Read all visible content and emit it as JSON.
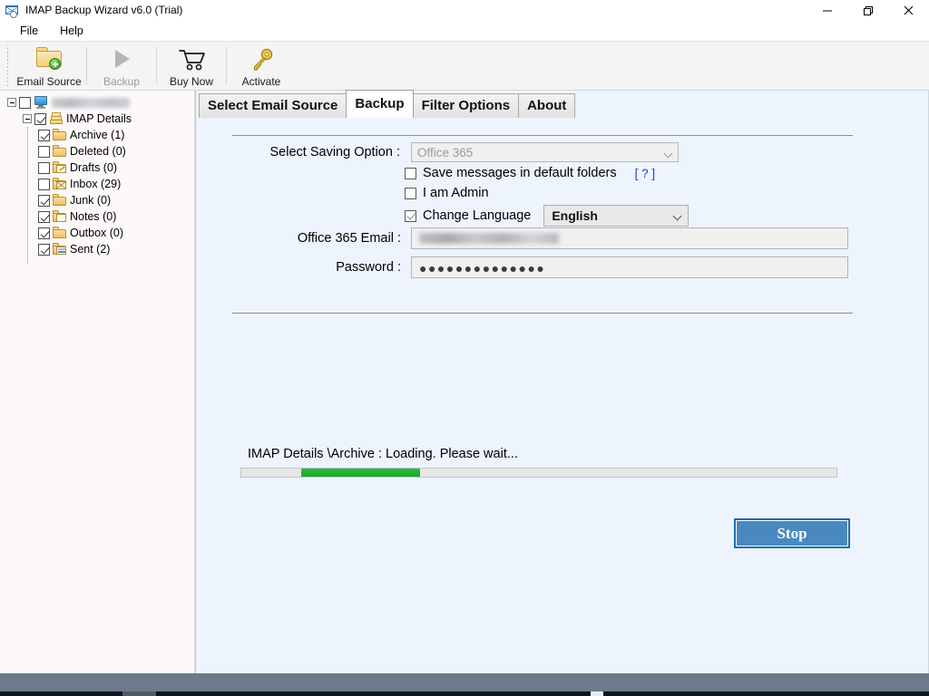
{
  "window": {
    "title": "IMAP Backup Wizard v6.0 (Trial)",
    "icon": "mail-wizard-icon",
    "minimize_label": "–",
    "maximize_label": "❐",
    "close_label": "✕"
  },
  "menubar": {
    "items": [
      {
        "label": "File",
        "name": "menu-file"
      },
      {
        "label": "Help",
        "name": "menu-help"
      }
    ]
  },
  "toolbar": {
    "items": [
      {
        "label": "Email Source",
        "icon": "folder-add-icon",
        "disabled": false
      },
      {
        "label": "Backup",
        "icon": "play-icon",
        "disabled": true
      },
      {
        "label": "Buy Now",
        "icon": "shopping-cart-icon",
        "disabled": false
      },
      {
        "label": "Activate",
        "icon": "key-icon",
        "disabled": false
      }
    ]
  },
  "tree": {
    "root": {
      "label": "",
      "redacted": true,
      "icon": "computer-monitor-icon",
      "expander": "minus",
      "checked": false
    },
    "account": {
      "label": "IMAP Details",
      "icon": "folder-stack-icon",
      "expander": "minus",
      "checked": true
    },
    "folders": [
      {
        "label": "Archive (1)",
        "icon": "folder-icon",
        "checked": true
      },
      {
        "label": "Deleted (0)",
        "icon": "folder-icon",
        "checked": false
      },
      {
        "label": "Drafts (0)",
        "icon": "folder-drafts-icon",
        "checked": false
      },
      {
        "label": "Inbox (29)",
        "icon": "folder-inbox-icon",
        "checked": false
      },
      {
        "label": "Junk (0)",
        "icon": "folder-icon",
        "checked": true
      },
      {
        "label": "Notes (0)",
        "icon": "folder-notes-icon",
        "checked": true
      },
      {
        "label": "Outbox (0)",
        "icon": "folder-icon",
        "checked": true
      },
      {
        "label": "Sent (2)",
        "icon": "folder-sent-icon",
        "checked": true
      }
    ]
  },
  "tabs": [
    {
      "label": "Select Email Source",
      "active": false
    },
    {
      "label": "Backup",
      "active": true
    },
    {
      "label": "Filter Options",
      "active": false
    },
    {
      "label": "About",
      "active": false
    }
  ],
  "form": {
    "saving_option": {
      "label": "Select Saving Option :",
      "value": "Office 365",
      "disabled": true
    },
    "checkboxes": [
      {
        "label": "Save messages in default folders",
        "checked": false,
        "name": "save-default-folders-checkbox"
      },
      {
        "label": "I am Admin",
        "checked": false,
        "name": "i-am-admin-checkbox"
      },
      {
        "label": "Change Language",
        "checked": true,
        "name": "change-language-checkbox"
      }
    ],
    "help_link": "[ ? ]",
    "language": {
      "value": "English"
    },
    "email": {
      "label": "Office 365 Email        :",
      "value": "",
      "redacted": true
    },
    "password": {
      "label": "Password :",
      "value": "●●●●●●●●●●●●●●"
    }
  },
  "progress": {
    "status_text": "IMAP Details \\Archive : Loading. Please wait...",
    "style": "marquee",
    "chunk_start_percent": 10,
    "chunk_width_percent": 20,
    "accent_color": "#1aa52c"
  },
  "actions": {
    "stop_label": "Stop",
    "stop_color": "#4a89c0"
  },
  "colors": {
    "left_panel": "#fdf9f9",
    "right_panel": "#edf4fd",
    "toolbar": "#f4f4f4",
    "taskbar": "#6c7a89",
    "link": "#2b36d8"
  }
}
